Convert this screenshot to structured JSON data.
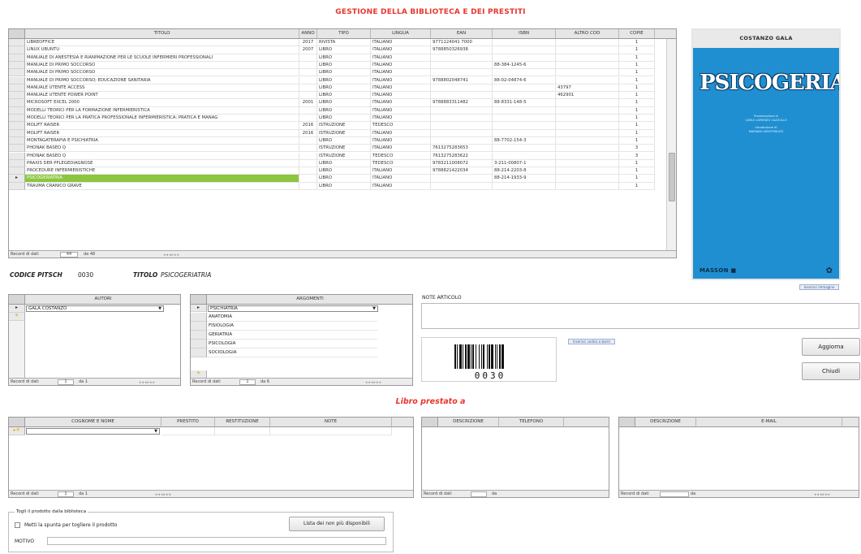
{
  "title": "GESTIONE DELLA BIBLIOTECA E DEI PRESTITI",
  "books_grid": {
    "columns": [
      "TITOLO",
      "ANNO",
      "TIPO",
      "LINGUA",
      "EAN",
      "ISBN",
      "ALTRO COD",
      "COPIE"
    ],
    "rows": [
      [
        "LIBREOFFICE",
        "2017",
        "RIVISTA",
        "ITALIANO",
        "9771124041 7000",
        "",
        "",
        "1"
      ],
      [
        "LINUX UBUNTU",
        "2007",
        "LIBRO",
        "ITALIANO",
        "9788850326938",
        "",
        "",
        "1"
      ],
      [
        "MANUALE DI ANESTESIA E RIANIMAZIONE PER LE SCUOLE INFERMIERI PROFESSIONALI",
        "",
        "LIBRO",
        "ITALIANO",
        "",
        "",
        "",
        "1"
      ],
      [
        "MANUALE DI PRIMO SOCCORSO",
        "",
        "LIBRO",
        "ITALIANO",
        "",
        "88-384-1245-6",
        "",
        "1"
      ],
      [
        "MANUALE DI PRIMO SOCCORSO",
        "",
        "LIBRO",
        "ITALIANO",
        "",
        "",
        "",
        "1"
      ],
      [
        "MANUALE DI PRIMO SOCCORSO; EDUCAZIONE SANITARIA",
        "",
        "LIBRO",
        "ITALIANO",
        "9788802048741",
        "88-02-04874-6",
        "",
        "1"
      ],
      [
        "MANUALE UTENTE ACCESS",
        "",
        "LIBRO",
        "ITALIANO",
        "",
        "",
        "43797",
        "1"
      ],
      [
        "MANUALE UTENTE POWER POINT",
        "",
        "LIBRO",
        "ITALIANO",
        "",
        "",
        "462901",
        "1"
      ],
      [
        "MICROSOFT EXCEL 2000",
        "2001",
        "LIBRO",
        "ITALIANO",
        "9788883311482",
        "88-8331-148-5",
        "",
        "1"
      ],
      [
        "MODELLI TEORICI PER LA FORMAZIONE INFERMIERISTICA",
        "",
        "LIBRO",
        "ITALIANO",
        "",
        "",
        "",
        "1"
      ],
      [
        "MODELLI TEORICI PER LA PRATICA PROFESSIONALE INFERMIERISTICA: PRATICA E MANAG",
        "",
        "LIBRO",
        "ITALIANO",
        "",
        "",
        "",
        "1"
      ],
      [
        "MOLIFT RAISER",
        "2016",
        "ISTRUZIONE",
        "TEDESCO",
        "",
        "",
        "",
        "1"
      ],
      [
        "MOLIFT RAISER",
        "2016",
        "ISTRUZIONE",
        "ITALIANO",
        "",
        "",
        "",
        "1"
      ],
      [
        "MONTAGATERAPIA E PSICHIATRIA",
        "",
        "LIBRO",
        "ITALIANO",
        "",
        "88-7702-154-3",
        "",
        "1"
      ],
      [
        "PHONAK BASEO Q",
        "",
        "ISTRUZIONE",
        "ITALIANO",
        "7613275283653",
        "",
        "",
        "3"
      ],
      [
        "PHONAK BASEO Q",
        "",
        "ISTRUZIONE",
        "TEDESCO",
        "7613275283622",
        "",
        "",
        "3"
      ],
      [
        "PRAXIS DER PFLEGEDIAGNOSE",
        "",
        "LIBRO",
        "TEDESCO",
        "9783211008072",
        "3-211-00807-1",
        "",
        "1"
      ],
      [
        "PROCEDURE INFERMIERISTICHE",
        "",
        "LIBRO",
        "ITALIANO",
        "9788821422034",
        "88-214-2203-8",
        "",
        "1"
      ],
      [
        "PSICOGERIATRIA",
        "",
        "LIBRO",
        "ITALIANO",
        "",
        "88-214-1933-9",
        "",
        "1"
      ],
      [
        "TRAUMA CRANICO GRAVE",
        "",
        "LIBRO",
        "ITALIANO",
        "",
        "",
        "",
        "1"
      ]
    ],
    "selected_index": 18,
    "nav": {
      "label": "Record di dati",
      "current": "44",
      "of": "da 48"
    }
  },
  "record": {
    "code_label": "CODICE PITSCH",
    "code_value": "0030",
    "title_label": "TITOLO",
    "title_value": "PSICOGERIATRIA"
  },
  "cover": {
    "author": "COSTANZO GALA",
    "title": "PSICOGERIATRIA",
    "pres1": "Presentazione di",
    "pres2": "CARLO LORENZO CAZZULLO",
    "intro1": "Introduzione di",
    "intro2": "MARIANO AMYOTRIUGO",
    "publisher": "MASSON"
  },
  "links": {
    "insert_image": "Inserisci immagine",
    "insert_barcode": "Inserisci codice a barre"
  },
  "autori": {
    "header": "AUTORI",
    "selected": "GALA COSTANZO",
    "nav": {
      "label": "Record di dati",
      "current": "1",
      "of": "da 1"
    }
  },
  "argomenti": {
    "header": "ARGOMENTI",
    "selected": "PSICHIATRIA",
    "items": [
      "ANATOMIA",
      "FISIOLOGIA",
      "GERIATRIA",
      "PSICOLOGIA",
      "SOCIOLOGIA"
    ],
    "nav": {
      "label": "Record di dati",
      "current": "1",
      "of": "da 6"
    }
  },
  "note": {
    "label": "NOTE ARTICOLO",
    "value": ""
  },
  "barcode": {
    "value": "0030"
  },
  "buttons": {
    "aggiorna": "Aggiorna",
    "chiudi": "Chiudi",
    "lista": "Lista dei non più disponibili"
  },
  "loan_title": "Libro prestato a",
  "loan_grid": {
    "columns": [
      "COGNOME E NOME",
      "PRESTITO",
      "RESTITUZIONE",
      "NOTE"
    ],
    "nav": {
      "label": "Record di dati",
      "current": "1",
      "of": "da 1"
    }
  },
  "phone_grid": {
    "columns": [
      "DESCRIZIONE",
      "TELEFONO"
    ],
    "nav": {
      "label": "Record di dati",
      "current": "",
      "of": "da"
    }
  },
  "email_grid": {
    "columns": [
      "DESCRIZIONE",
      "E-MAIL"
    ],
    "nav": {
      "label": "Record di dati",
      "current": "",
      "of": "da"
    }
  },
  "remove": {
    "group_label": "Togli il prodotto dalla biblioteca",
    "checkbox_label": "Metti la spunta per togliere il prodotto",
    "checked": false,
    "motivo_label": "MOTIVO",
    "motivo_value": ""
  }
}
